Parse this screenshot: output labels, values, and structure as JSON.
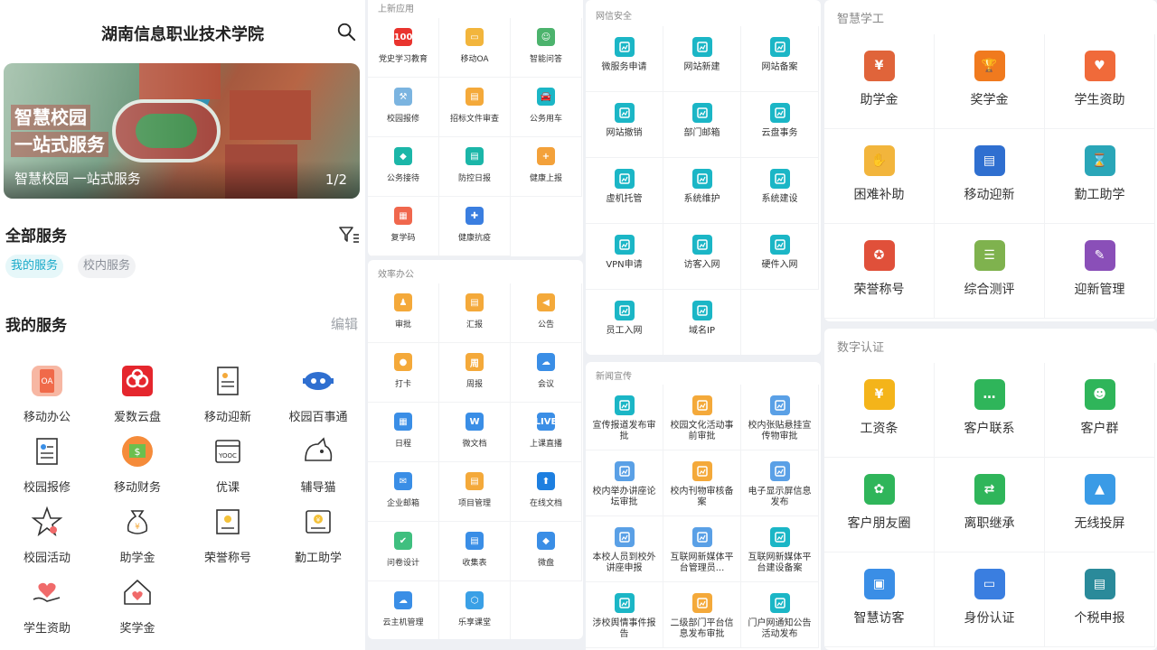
{
  "p1": {
    "title": "湖南信息职业技术学院",
    "banner": {
      "line1": "智慧校园",
      "line2": "一站式服务",
      "caption": "智慧校园 一站式服务",
      "page": "1/2"
    },
    "all_services": "全部服务",
    "pill_mine": "我的服务",
    "pill_campus": "校内服务",
    "mine_title": "我的服务",
    "edit": "编辑",
    "services": [
      "移动办公",
      "爱数云盘",
      "移动迎新",
      "校园百事通",
      "校园报修",
      "移动财务",
      "优课",
      "辅导猫",
      "校园活动",
      "助学金",
      "荣誉称号",
      "勤工助学",
      "学生资助",
      "奖学金"
    ]
  },
  "p2": {
    "sec1_title": "上新应用",
    "sec1": [
      {
        "label": "党史学习教育",
        "glyph": "100",
        "color": "#e9342e"
      },
      {
        "label": "移动OA",
        "glyph": "▭",
        "color": "#f2b53c"
      },
      {
        "label": "智能问答",
        "glyph": "☺",
        "color": "#4cb36d"
      },
      {
        "label": "校园报修",
        "glyph": "⚒",
        "color": "#7bb4e0"
      },
      {
        "label": "招标文件审查",
        "glyph": "▤",
        "color": "#f4a93a"
      },
      {
        "label": "公务用车",
        "glyph": "🚘",
        "color": "#1bb6c6"
      },
      {
        "label": "公务接待",
        "glyph": "◆",
        "color": "#1bb6a8"
      },
      {
        "label": "防控日报",
        "glyph": "▤",
        "color": "#1bb6a8"
      },
      {
        "label": "健康上报",
        "glyph": "+",
        "color": "#f3a13a"
      },
      {
        "label": "复学码",
        "glyph": "▦",
        "color": "#f0674d"
      },
      {
        "label": "健康抗疫",
        "glyph": "✚",
        "color": "#3a7ee0"
      }
    ],
    "sec2_title": "效率办公",
    "sec2": [
      {
        "label": "审批",
        "glyph": "♟",
        "color": "#f4a93a"
      },
      {
        "label": "汇报",
        "glyph": "▤",
        "color": "#f4a93a"
      },
      {
        "label": "公告",
        "glyph": "◀",
        "color": "#f4a93a"
      },
      {
        "label": "打卡",
        "glyph": "●",
        "color": "#f4a93a"
      },
      {
        "label": "周报",
        "glyph": "周",
        "color": "#f4a93a"
      },
      {
        "label": "会议",
        "glyph": "☁",
        "color": "#3a8ee6"
      },
      {
        "label": "日程",
        "glyph": "▦",
        "color": "#3a8ee6"
      },
      {
        "label": "微文档",
        "glyph": "W",
        "color": "#3a8ee6"
      },
      {
        "label": "上课直播",
        "glyph": "LIVE",
        "color": "#3a8ee6"
      },
      {
        "label": "企业邮箱",
        "glyph": "✉",
        "color": "#3a8ee6"
      },
      {
        "label": "项目管理",
        "glyph": "▤",
        "color": "#f4a93a"
      },
      {
        "label": "在线文档",
        "glyph": "⬆",
        "color": "#1d7fe0"
      },
      {
        "label": "问卷设计",
        "glyph": "✔",
        "color": "#3fbf7f"
      },
      {
        "label": "收集表",
        "glyph": "▤",
        "color": "#3a8ee6"
      },
      {
        "label": "微盘",
        "glyph": "◆",
        "color": "#3a8ee6"
      },
      {
        "label": "云主机管理",
        "glyph": "☁",
        "color": "#3a8ee6"
      },
      {
        "label": "乐享课堂",
        "glyph": "⬡",
        "color": "#3aa0e6"
      }
    ]
  },
  "p3": {
    "sec1_title": "网信安全",
    "sec1": [
      "微服务申请",
      "网站新建",
      "网站备案",
      "网站撤销",
      "部门邮箱",
      "云盘事务",
      "虚机托管",
      "系统维护",
      "系统建设",
      "VPN申请",
      "访客入网",
      "硬件入网",
      "员工入网",
      "域名IP"
    ],
    "sec2_title": "新闻宣传",
    "sec2": [
      {
        "label": "宣传报道发布审批",
        "color": "#1bb6c6"
      },
      {
        "label": "校园文化活动事前审批",
        "color": "#f4a93a"
      },
      {
        "label": "校内张贴悬挂宣传物审批",
        "color": "#5aa0e6"
      },
      {
        "label": "校内举办讲座论坛审批",
        "color": "#5aa0e6"
      },
      {
        "label": "校内刊物审核备案",
        "color": "#f4a93a"
      },
      {
        "label": "电子显示屏信息发布",
        "color": "#5aa0e6"
      },
      {
        "label": "本校人员到校外讲座申报",
        "color": "#5aa0e6"
      },
      {
        "label": "互联网新媒体平台管理员...",
        "color": "#5aa0e6"
      },
      {
        "label": "互联网新媒体平台建设备案",
        "color": "#1bb6c6"
      },
      {
        "label": "涉校舆情事件报告",
        "color": "#1bb6c6"
      },
      {
        "label": "二级部门平台信息发布审批",
        "color": "#f4a93a"
      },
      {
        "label": "门户网通知公告活动发布",
        "color": "#1bb6c6"
      }
    ]
  },
  "p4": {
    "sec1_title": "智慧学工",
    "sec1": [
      {
        "label": "助学金",
        "glyph": "¥",
        "color": "#e0643a"
      },
      {
        "label": "奖学金",
        "glyph": "🏆",
        "color": "#f07a1e"
      },
      {
        "label": "学生资助",
        "glyph": "♥",
        "color": "#f06a3a"
      },
      {
        "label": "困难补助",
        "glyph": "✋",
        "color": "#f2b53c"
      },
      {
        "label": "移动迎新",
        "glyph": "▤",
        "color": "#2f6fd0"
      },
      {
        "label": "勤工助学",
        "glyph": "⌛",
        "color": "#2aa6b8"
      },
      {
        "label": "荣誉称号",
        "glyph": "✪",
        "color": "#e0503a"
      },
      {
        "label": "综合测评",
        "glyph": "☰",
        "color": "#7fb24e"
      },
      {
        "label": "迎新管理",
        "glyph": "✎",
        "color": "#8a4fb8"
      }
    ],
    "sec2_title": "数字认证",
    "sec2": [
      {
        "label": "工资条",
        "glyph": "¥",
        "color": "#f4b41a"
      },
      {
        "label": "客户联系",
        "glyph": "…",
        "color": "#2fb55a"
      },
      {
        "label": "客户群",
        "glyph": "☻",
        "color": "#2fb55a"
      },
      {
        "label": "客户朋友圈",
        "glyph": "✿",
        "color": "#2fb55a"
      },
      {
        "label": "离职继承",
        "glyph": "⇄",
        "color": "#2fb55a"
      },
      {
        "label": "无线投屏",
        "glyph": "▲",
        "color": "#3a9be6"
      },
      {
        "label": "智慧访客",
        "glyph": "▣",
        "color": "#3a8ee6"
      },
      {
        "label": "身份认证",
        "glyph": "▭",
        "color": "#3a7ee0"
      },
      {
        "label": "个税申报",
        "glyph": "▤",
        "color": "#2a8a9a"
      }
    ]
  }
}
